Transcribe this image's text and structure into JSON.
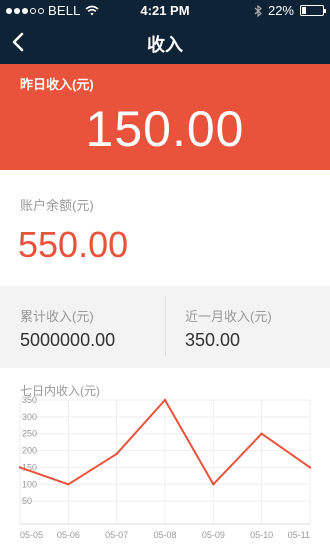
{
  "status_bar": {
    "carrier": "BELL",
    "time": "4:21 PM",
    "battery": "22%",
    "battery_fraction": 0.22
  },
  "header": {
    "title": "收入"
  },
  "yesterday": {
    "label": "昨日收入(元)",
    "value": "150.00"
  },
  "balance": {
    "label": "账户余额(元)",
    "value": "550.00"
  },
  "stats": {
    "total_label": "累计收入(元)",
    "total_value": "5000000.00",
    "month_label": "近一月收入(元)",
    "month_value": "350.00"
  },
  "chart_title": "七日内收入(元)",
  "colors": {
    "header_bg": "#0f2336",
    "accent": "#e9523b"
  },
  "chart_data": {
    "type": "line",
    "title": "七日内收入(元)",
    "categories": [
      "05-05",
      "05-06",
      "05-07",
      "05-08",
      "05-09",
      "05-10",
      "05-11"
    ],
    "values": [
      150,
      100,
      190,
      350,
      100,
      250,
      150
    ],
    "y_ticks": [
      50,
      100,
      150,
      200,
      250,
      300,
      350
    ],
    "ylim": [
      0,
      350
    ],
    "grid": true,
    "line_color": "#e9523b"
  }
}
